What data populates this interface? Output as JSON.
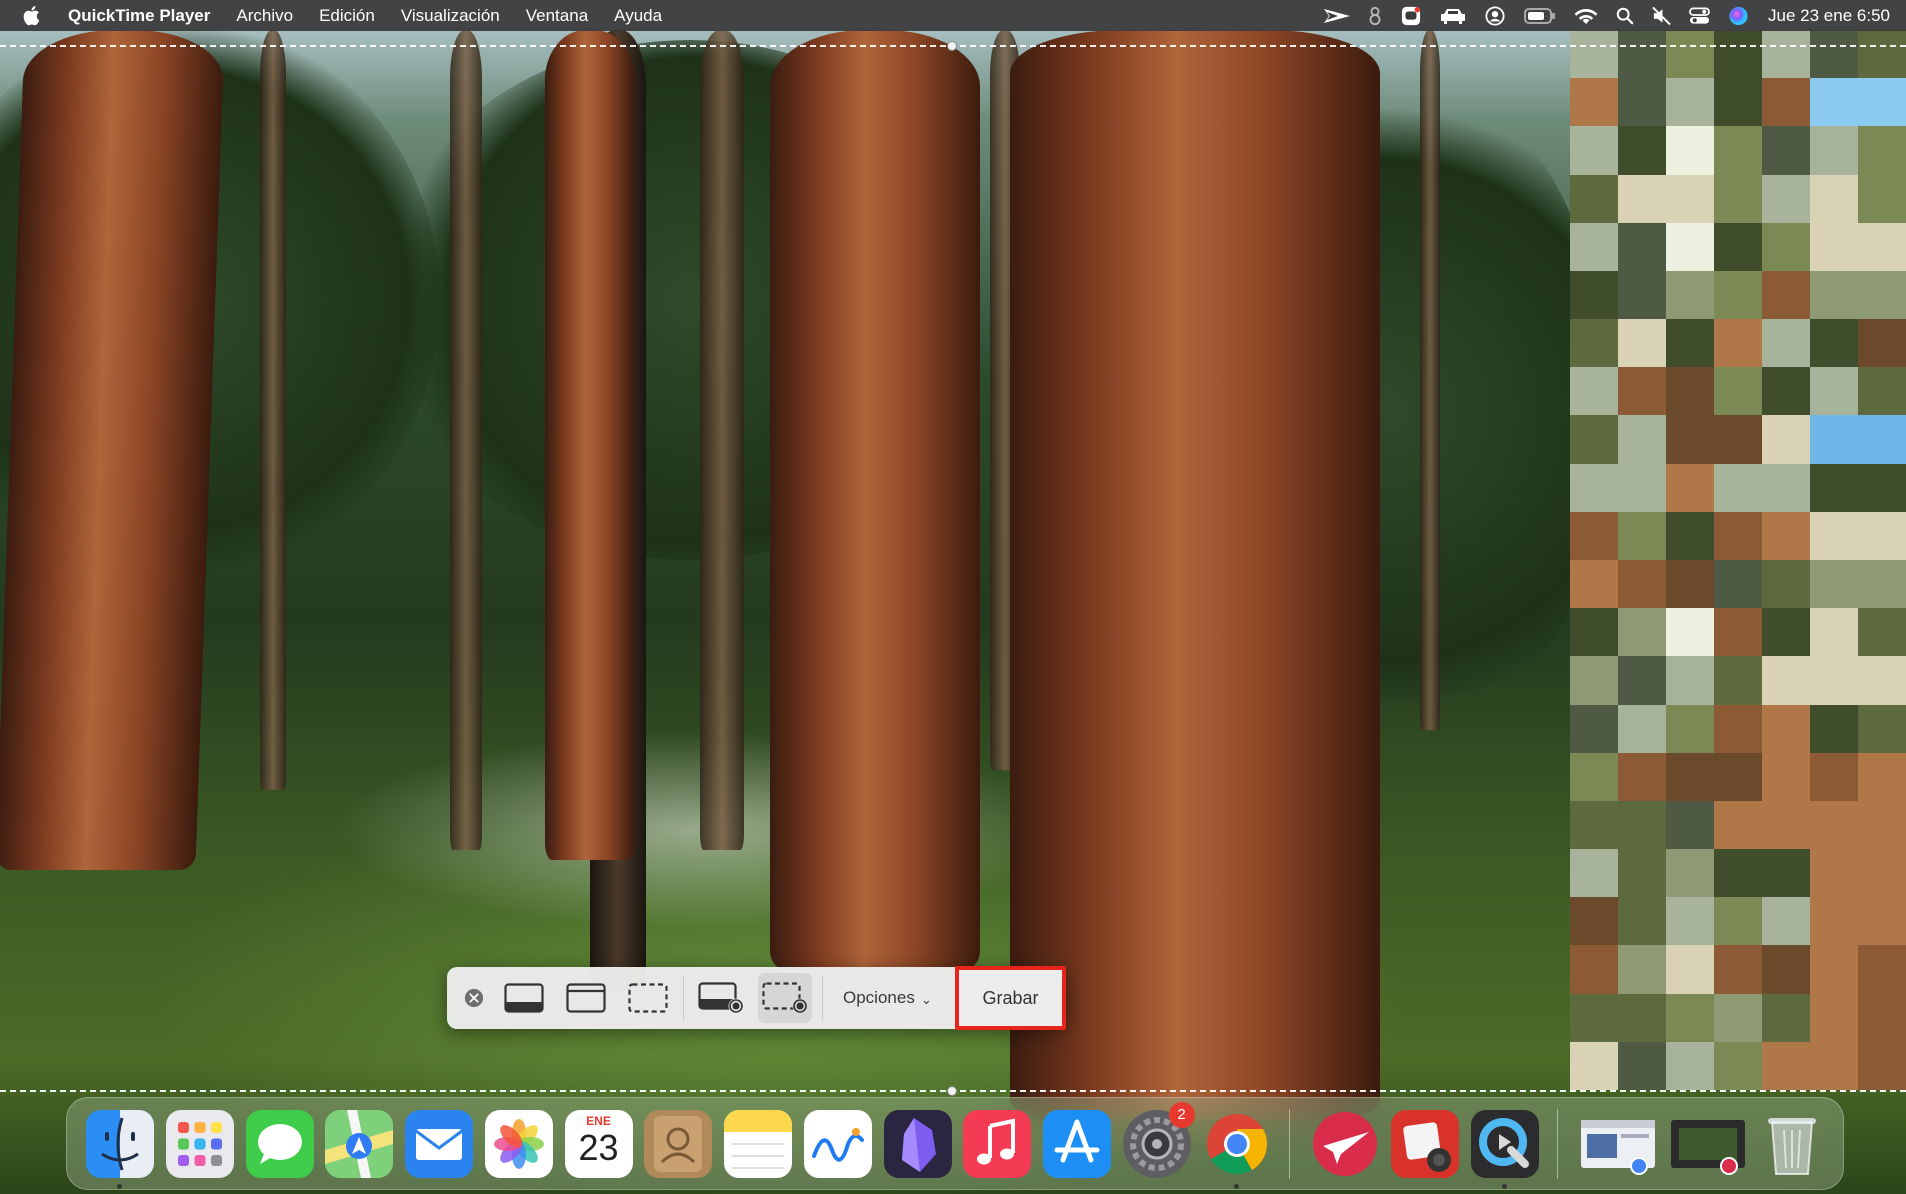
{
  "menubar": {
    "apple_icon": "apple-logo",
    "app_name": "QuickTime Player",
    "menus": [
      "Archivo",
      "Edición",
      "Visualización",
      "Ventana",
      "Ayuda"
    ],
    "status_icons": [
      "send-arrow-icon",
      "bluetooth-ish-icon",
      "cloud-app-icon",
      "car-icon",
      "user-circle-icon",
      "battery-icon",
      "wifi-icon",
      "search-icon",
      "mute-icon",
      "control-center-icon",
      "siri-icon"
    ],
    "clock": "Jue 23 ene 6:50"
  },
  "capture_toolbar": {
    "options_label": "Opciones",
    "record_label": "Grabar",
    "accent": "#e8251c"
  },
  "dock": {
    "calendar_month": "ENE",
    "calendar_day": "23",
    "settings_badge": "2"
  }
}
